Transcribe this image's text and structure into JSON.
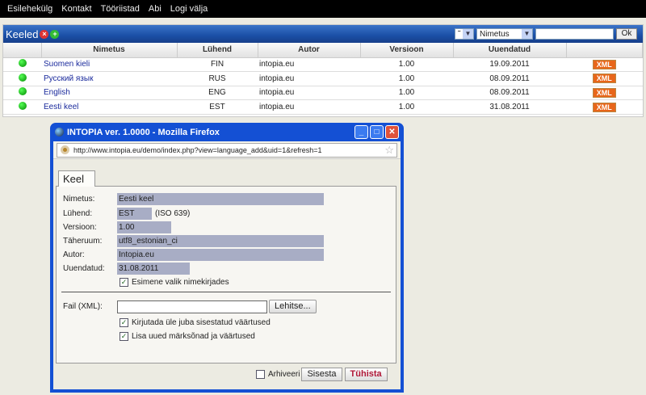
{
  "nav": [
    "Esilehekülg",
    "Kontakt",
    "Tööriistad",
    "Abi",
    "Logi välja"
  ],
  "panel": {
    "title": "Keeled",
    "filter_order": "˜",
    "filter_field": "Nimetus",
    "search_value": "",
    "ok_label": "Ok"
  },
  "table": {
    "headers": [
      "",
      "Nimetus",
      "Lühend",
      "Autor",
      "Versioon",
      "Uuendatud",
      ""
    ],
    "rows": [
      {
        "name": "Suomen kieli",
        "code": "FIN",
        "author": "intopia.eu",
        "version": "1.00",
        "updated": "19.09.2011",
        "xml": "XML"
      },
      {
        "name": "Русский язык",
        "code": "RUS",
        "author": "intopia.eu",
        "version": "1.00",
        "updated": "08.09.2011",
        "xml": "XML"
      },
      {
        "name": "English",
        "code": "ENG",
        "author": "intopia.eu",
        "version": "1.00",
        "updated": "08.09.2011",
        "xml": "XML"
      },
      {
        "name": "Eesti keel",
        "code": "EST",
        "author": "intopia.eu",
        "version": "1.00",
        "updated": "31.08.2011",
        "xml": "XML"
      }
    ]
  },
  "popup": {
    "title": "INTOPIA ver. 1.0000 - Mozilla Firefox",
    "url": "http://www.intopia.eu/demo/index.php?view=language_add&uid=1&refresh=1",
    "tab": "Keel",
    "fields": {
      "name_label": "Nimetus:",
      "name": "Eesti keel",
      "code_label": "Lühend:",
      "code": "EST",
      "code_note": "(ISO 639)",
      "version_label": "Versioon:",
      "version": "1.00",
      "charset_label": "Täheruum:",
      "charset": "utf8_estonian_ci",
      "author_label": "Autor:",
      "author": "Intopia.eu",
      "updated_label": "Uuendatud:",
      "updated": "31.08.2011",
      "first_choice": "Esimene valik nimekirjades"
    },
    "file_label": "Fail (XML):",
    "file_value": "",
    "browse": "Lehitse...",
    "overwrite": "Kirjutada üle juba sisestatud väärtused",
    "add_new": "Lisa uued märksõnad ja väärtused",
    "archive": "Arhiveeri",
    "submit": "Sisesta",
    "cancel": "Tühista"
  }
}
